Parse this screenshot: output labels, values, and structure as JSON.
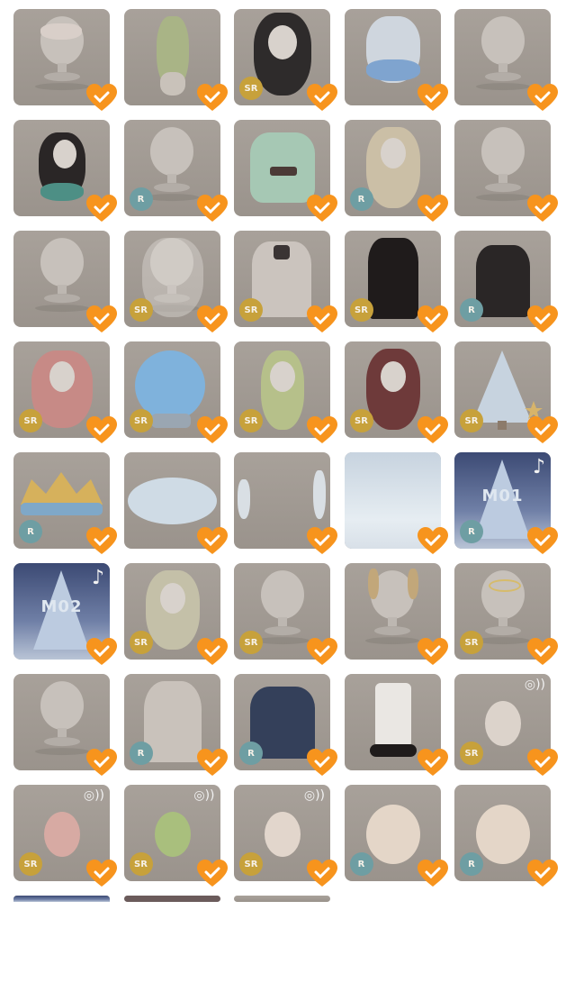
{
  "grid": {
    "items": [
      {
        "rarity": "",
        "icon": "hair-accessory-icon"
      },
      {
        "rarity": "",
        "icon": "outfit-icon"
      },
      {
        "rarity": "SR",
        "icon": "hairstyle-icon"
      },
      {
        "rarity": "",
        "icon": "hairstyle-icon"
      },
      {
        "rarity": "",
        "icon": "eyes-icon"
      },
      {
        "rarity": "",
        "icon": "hairstyle-icon"
      },
      {
        "rarity": "R",
        "icon": "eyes-icon"
      },
      {
        "rarity": "",
        "icon": "outfit-icon"
      },
      {
        "rarity": "R",
        "icon": "hairstyle-icon"
      },
      {
        "rarity": "",
        "icon": "eyes-icon"
      },
      {
        "rarity": "",
        "icon": "mouth-icon"
      },
      {
        "rarity": "SR",
        "icon": "veil-icon"
      },
      {
        "rarity": "SR",
        "icon": "dress-icon"
      },
      {
        "rarity": "SR",
        "icon": "dress-icon"
      },
      {
        "rarity": "R",
        "icon": "dress-icon"
      },
      {
        "rarity": "SR",
        "icon": "hairstyle-icon"
      },
      {
        "rarity": "SR",
        "icon": "crystal-ball-icon"
      },
      {
        "rarity": "SR",
        "icon": "hairstyle-icon"
      },
      {
        "rarity": "SR",
        "icon": "hairstyle-icon"
      },
      {
        "rarity": "SR",
        "icon": "christmas-tree-icon"
      },
      {
        "rarity": "R",
        "icon": "crown-icon"
      },
      {
        "rarity": "",
        "icon": "cloud-icon"
      },
      {
        "rarity": "",
        "icon": "frame-icon"
      },
      {
        "rarity": "",
        "icon": "background-icon"
      },
      {
        "rarity": "R",
        "icon": "music-icon",
        "label": "M01"
      },
      {
        "rarity": "",
        "icon": "music-icon",
        "label": "M02"
      },
      {
        "rarity": "SR",
        "icon": "hairstyle-icon"
      },
      {
        "rarity": "SR",
        "icon": "eyes-icon"
      },
      {
        "rarity": "",
        "icon": "antlers-icon"
      },
      {
        "rarity": "SR",
        "icon": "halo-icon"
      },
      {
        "rarity": "",
        "icon": "hair-accessory-icon"
      },
      {
        "rarity": "R",
        "icon": "veil-icon"
      },
      {
        "rarity": "R",
        "icon": "dress-icon"
      },
      {
        "rarity": "",
        "icon": "shoes-icon"
      },
      {
        "rarity": "SR",
        "icon": "pet-icon"
      },
      {
        "rarity": "SR",
        "icon": "pet-icon"
      },
      {
        "rarity": "SR",
        "icon": "pet-icon"
      },
      {
        "rarity": "SR",
        "icon": "pet-icon"
      },
      {
        "rarity": "R",
        "icon": "pet-icon"
      },
      {
        "rarity": "R",
        "icon": "pet-icon"
      }
    ]
  },
  "colors": {
    "heart": "#f7941d",
    "sr_badge": "#c7a13b",
    "r_badge": "#6e9ea3",
    "tile_bg": "#a29b94"
  }
}
